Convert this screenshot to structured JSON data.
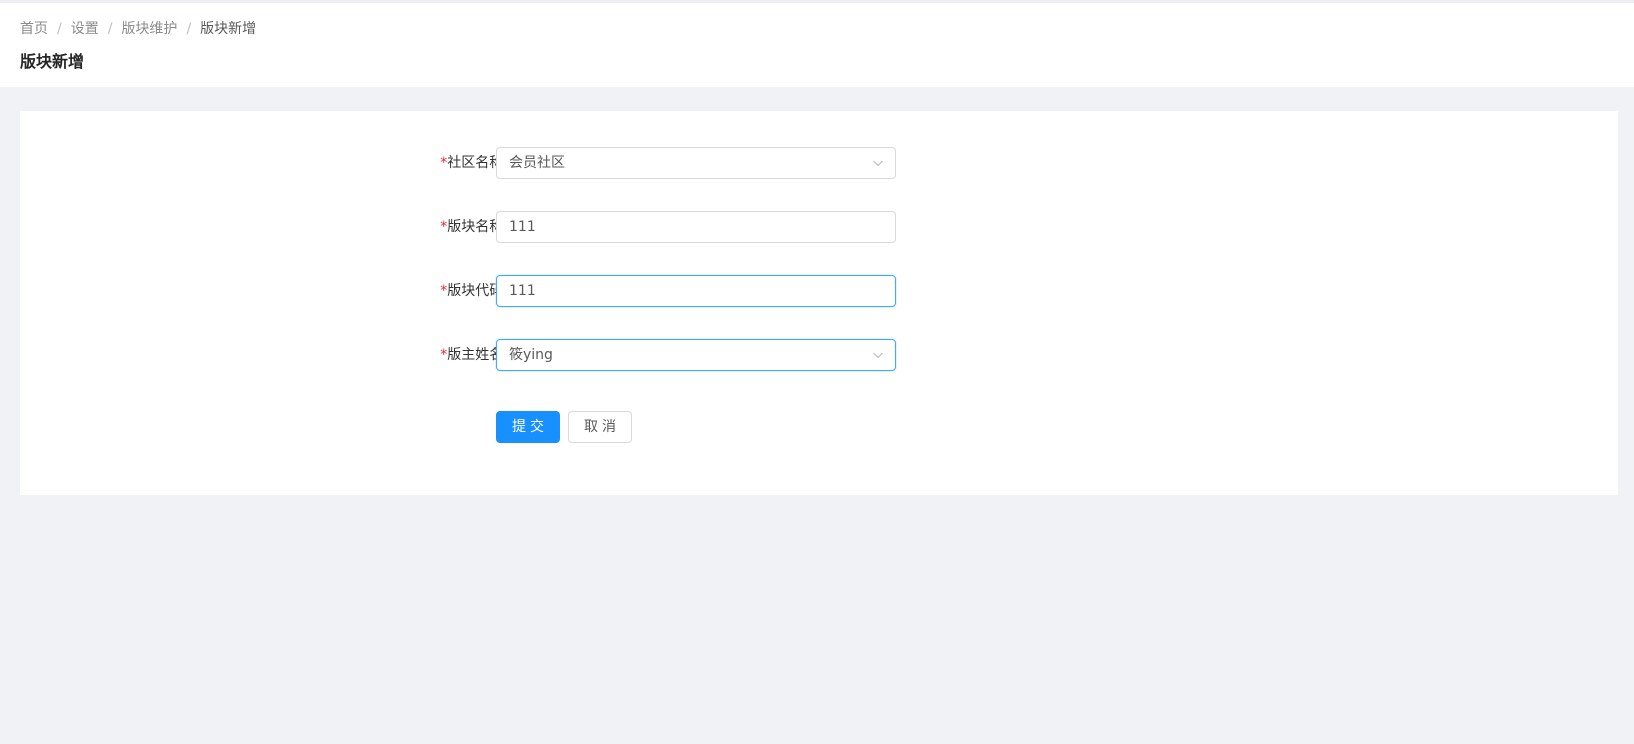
{
  "breadcrumb": {
    "items": [
      "首页",
      "设置",
      "版块维护",
      "版块新增"
    ],
    "separator": "/"
  },
  "page": {
    "title": "版块新增"
  },
  "form": {
    "required_mark": "*",
    "community": {
      "label": "社区名称:",
      "value": "会员社区"
    },
    "board_name": {
      "label": "版块名称:",
      "value": "111"
    },
    "board_code": {
      "label": "版块代码:",
      "value": "111"
    },
    "moderator": {
      "label": "版主姓名:",
      "value": "筱ying"
    },
    "submit_label": "提交",
    "cancel_label": "取消"
  },
  "colors": {
    "primary": "#1890ff",
    "required": "#f5222d",
    "focus_border": "#40a9ff",
    "background": "#f0f2f5"
  },
  "icons": {
    "select_arrow": "chevron-down-icon"
  }
}
